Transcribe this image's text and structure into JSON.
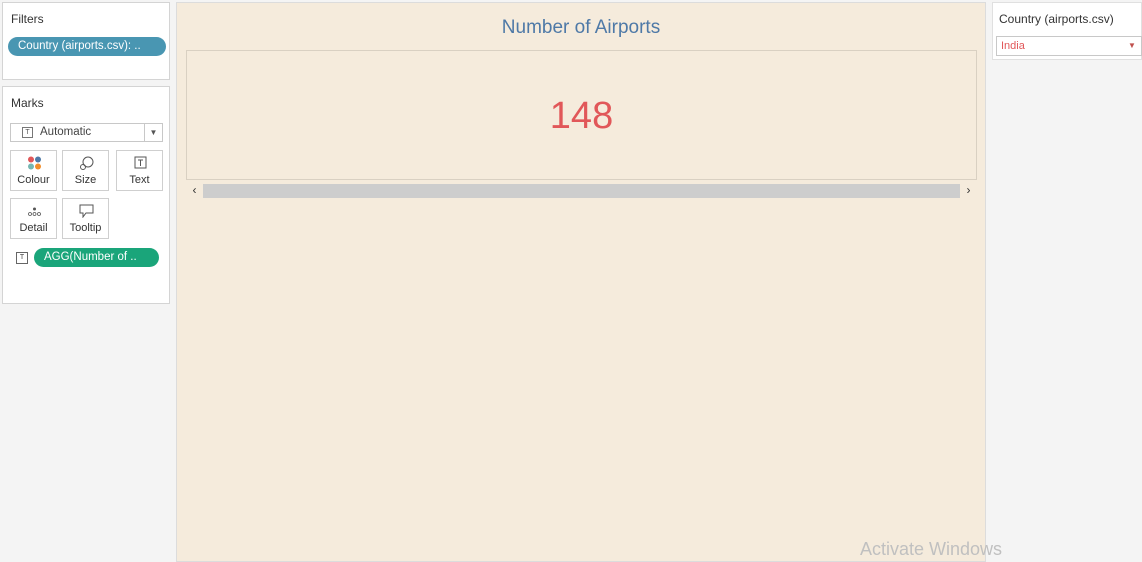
{
  "filters": {
    "title": "Filters",
    "pill_label": "Country (airports.csv): .."
  },
  "marks": {
    "title": "Marks",
    "mark_type": "Automatic",
    "buttons": {
      "colour": "Colour",
      "size": "Size",
      "text": "Text",
      "detail": "Detail",
      "tooltip": "Tooltip"
    },
    "text_pill": "AGG(Number of .."
  },
  "view": {
    "title": "Number of Airports",
    "kpi_value": "148"
  },
  "country_filter": {
    "title": "Country (airports.csv)",
    "selected": "India"
  },
  "watermark": "Activate Windows",
  "colors": {
    "filter_pill": "#4996b2",
    "measure_pill": "#1aa57a",
    "view_background": "#f5ebdc",
    "title": "#4e79a7",
    "kpi": "#e15759"
  }
}
